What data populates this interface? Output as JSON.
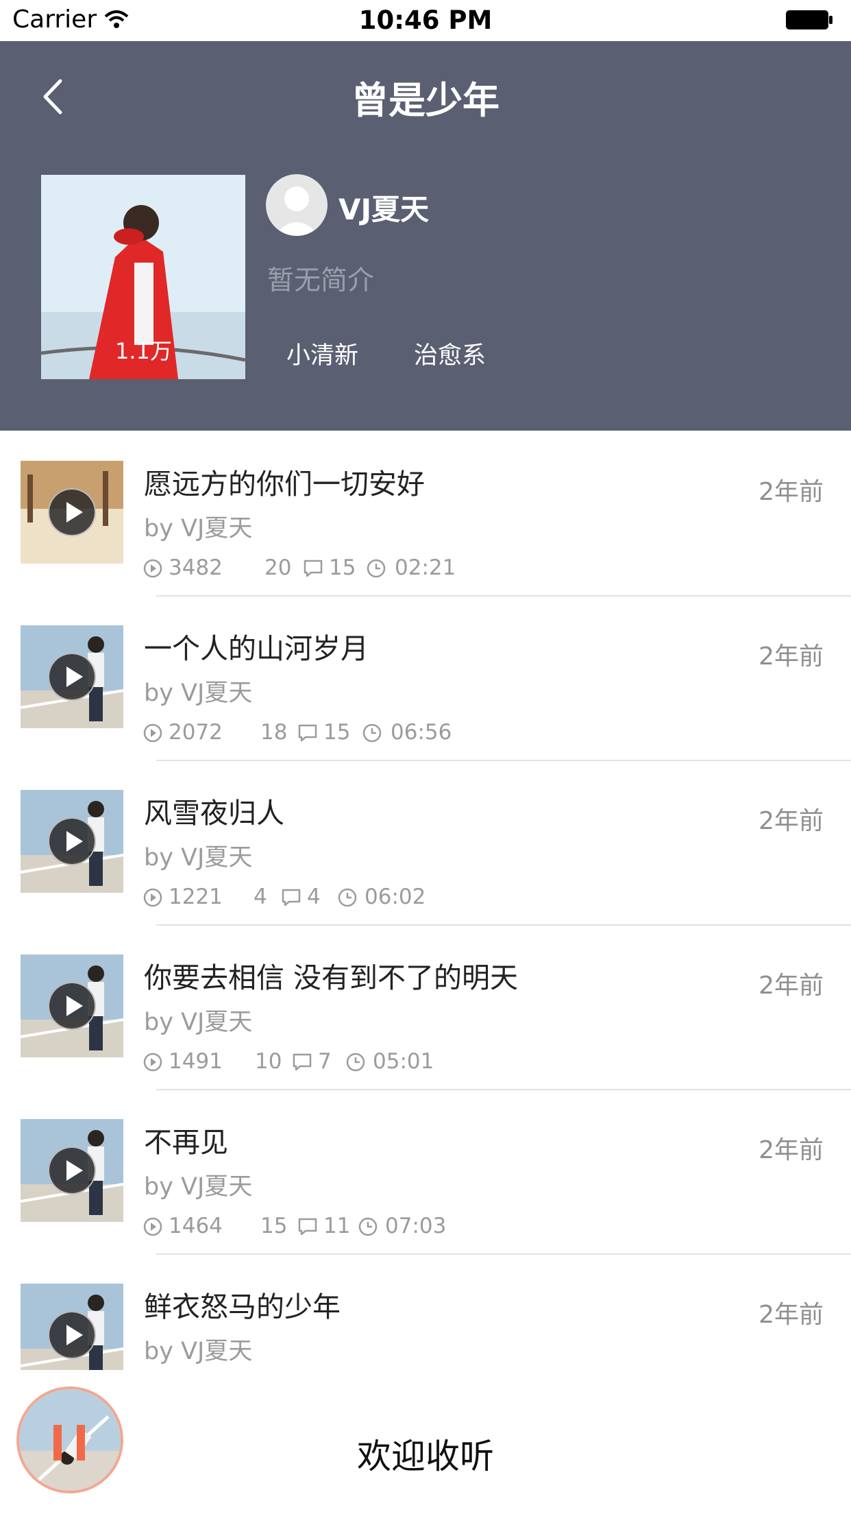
{
  "status_bar": {
    "carrier": "Carrier",
    "time": "10:46 PM"
  },
  "header": {
    "title": "曾是少年",
    "cover_count": "1.1万",
    "author_name": "VJ夏天",
    "bio": "暂无简介",
    "tags": [
      "小清新",
      "治愈系"
    ]
  },
  "tracks": [
    {
      "title": "愿远方的你们一切安好",
      "by": "by VJ夏天",
      "time": "2年前",
      "plays": "3482",
      "likes": "20",
      "comments": "15",
      "duration": "02:21"
    },
    {
      "title": "一个人的山河岁月",
      "by": "by VJ夏天",
      "time": "2年前",
      "plays": "2072",
      "likes": "18",
      "comments": "15",
      "duration": "06:56"
    },
    {
      "title": "风雪夜归人",
      "by": "by VJ夏天",
      "time": "2年前",
      "plays": "1221",
      "likes": "4",
      "comments": "4",
      "duration": "06:02"
    },
    {
      "title": "你要去相信 没有到不了的明天",
      "by": "by VJ夏天",
      "time": "2年前",
      "plays": "1491",
      "likes": "10",
      "comments": "7",
      "duration": "05:01"
    },
    {
      "title": "不再见",
      "by": "by VJ夏天",
      "time": "2年前",
      "plays": "1464",
      "likes": "15",
      "comments": "11",
      "duration": "07:03"
    },
    {
      "title": "鲜衣怒马的少年",
      "by": "by VJ夏天",
      "time": "2年前"
    }
  ],
  "bottom_bar": {
    "welcome_text": "欢迎收听"
  },
  "colors": {
    "header_bg": "#5a5f72",
    "accent": "#f06a4a"
  }
}
